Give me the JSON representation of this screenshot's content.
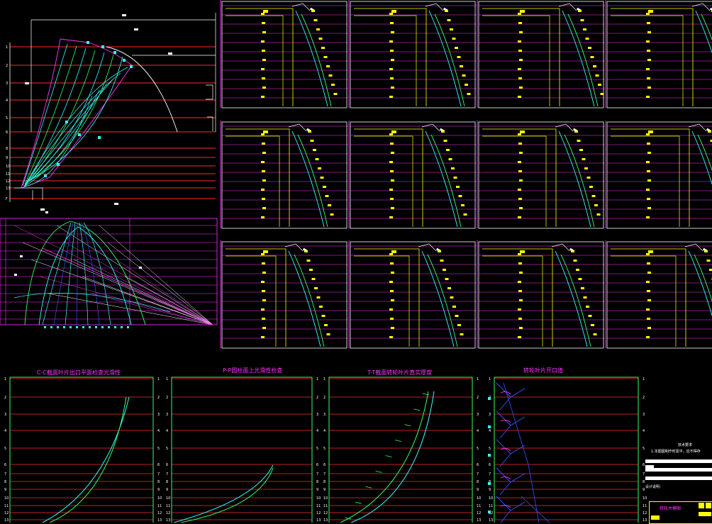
{
  "colors": {
    "background": "#000000",
    "station_line": "#ff2a2a",
    "frame": "#ffffff",
    "grid_magenta": "#ff33ff",
    "panel_frame": "#ffff00",
    "cyan": "#33ffff",
    "green": "#33ff66",
    "blue": "#3355ff",
    "label_yellow": "#ffff00"
  },
  "station_labels": [
    "1",
    "2",
    "3",
    "4",
    "5",
    "6",
    "7",
    "8",
    "9",
    "10",
    "11",
    "12",
    "13"
  ],
  "upper_left_labels": [
    "1",
    "2",
    "3",
    "4",
    "5",
    "6",
    "8",
    "9",
    "10",
    "11",
    "12",
    "13",
    "F"
  ],
  "bottom_titles": [
    "C-C截面叶片出口平面检查光滑性",
    "P-P圆柱面上光滑性检查",
    "T-T截面转轮叶片真实厚度",
    "转轮叶片开口值"
  ],
  "notes": {
    "heading": "技术要求",
    "line1": "1.本图图制作时需平，应不得存"
  },
  "title_block": {
    "label": "转轮木模图",
    "small_note": "设计说明："
  },
  "icons": {
    "grid_cells": "yellow-rect-glyph",
    "arrow_marker": "white-arrow-icon"
  }
}
